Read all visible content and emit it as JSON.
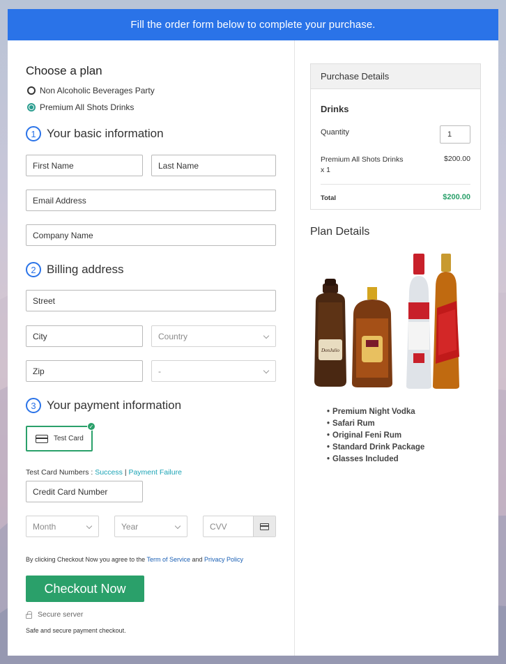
{
  "banner": {
    "text": "Fill the order form below to complete your purchase."
  },
  "plan": {
    "title": "Choose a plan",
    "options": [
      {
        "label": "Non Alcoholic Beverages Party",
        "selected": false
      },
      {
        "label": "Premium All Shots Drinks",
        "selected": true
      }
    ]
  },
  "basic": {
    "step": "1",
    "title": "Your basic information",
    "first_name": "First Name",
    "last_name": "Last Name",
    "email": "Email Address",
    "company": "Company Name"
  },
  "billing": {
    "step": "2",
    "title": "Billing address",
    "street": "Street",
    "city": "City",
    "country": "Country",
    "zip": "Zip",
    "state": "-"
  },
  "payment": {
    "step": "3",
    "title": "Your payment information",
    "card_option": "Test Card",
    "test_numbers_label": "Test Card Numbers :",
    "success_link": "Success",
    "separator": "|",
    "failure_link": "Payment Failure",
    "card_number": "Credit Card Number",
    "month": "Month",
    "year": "Year",
    "cvv": "CVV"
  },
  "agreement": {
    "prefix": "By clicking Checkout Now you agree to the",
    "terms": "Term of Service",
    "and": "and",
    "privacy": "Privacy Policy"
  },
  "checkout_label": "Checkout Now",
  "secure_label": "Secure server",
  "safe_label": "Safe and secure payment checkout.",
  "purchase": {
    "header": "Purchase Details",
    "section": "Drinks",
    "quantity_label": "Quantity",
    "quantity_value": "1",
    "item_name": "Premium All Shots Drinks",
    "item_qty": "x 1",
    "item_price": "$200.00",
    "total_label": "Total",
    "total_value": "$200.00"
  },
  "plan_details": {
    "title": "Plan Details",
    "features": [
      "Premium Night Vodka",
      "Safari Rum",
      "Original Feni Rum",
      "Standard Drink Package",
      "Glasses Included"
    ]
  },
  "colors": {
    "accent_blue": "#2a73e8",
    "green": "#2aa06a",
    "link_teal": "#1aa3b5"
  }
}
